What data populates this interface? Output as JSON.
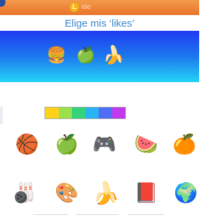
{
  "header": {
    "coin_symbol": "L",
    "coins": "650",
    "title": "Elige mis ‘likes’"
  },
  "banner": {
    "items": [
      {
        "name": "hamburger-icon",
        "glyph": "🍔"
      },
      {
        "name": "green-apple-icon",
        "glyph": "🍏"
      },
      {
        "name": "banana-icon",
        "glyph": "🍌"
      }
    ]
  },
  "palette": {
    "colors": [
      "#ffd21a",
      "#9be24a",
      "#35d37c",
      "#27b3f4",
      "#4f6ef6",
      "#c338ef"
    ]
  },
  "grid": {
    "row1": [
      {
        "name": "basketball-icon",
        "glyph": "🏀"
      },
      {
        "name": "green-apple-icon",
        "glyph": "🍏"
      },
      {
        "name": "game-controller-icon",
        "glyph": "🎮"
      },
      {
        "name": "watermelon-icon",
        "glyph": "🍉"
      },
      {
        "name": "orange-icon",
        "glyph": "🍊"
      }
    ],
    "row2": [
      {
        "name": "bowling-icon",
        "glyph": "🎳"
      },
      {
        "name": "drawing-icon",
        "glyph": "🎨"
      },
      {
        "name": "banana-icon",
        "glyph": "🍌"
      },
      {
        "name": "book-icon",
        "glyph": "📕"
      },
      {
        "name": "globe-icon",
        "glyph": "🌍"
      }
    ]
  }
}
